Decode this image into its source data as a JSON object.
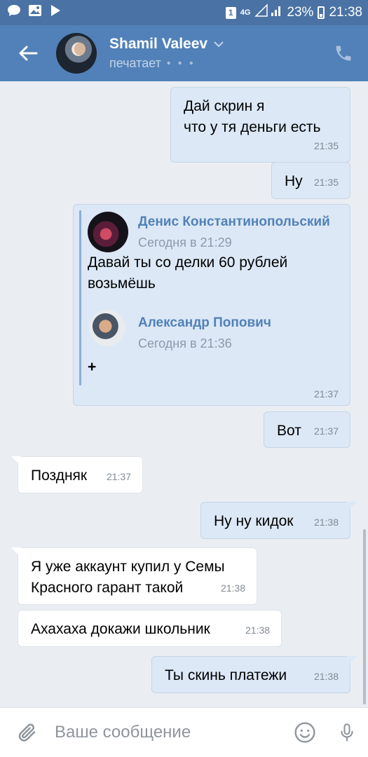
{
  "status_bar": {
    "network": "4G",
    "battery": "23%",
    "time": "21:38"
  },
  "header": {
    "name": "Shamil Valeev",
    "status": "печатает",
    "typing_dots": "• • •"
  },
  "messages": [
    {
      "dir": "out",
      "text": "Дай скрин я\n  что у тя деньги есть",
      "time": "21:35"
    },
    {
      "dir": "out",
      "text": "Ну",
      "time": "21:35"
    },
    {
      "dir": "out",
      "time": "21:37"
    },
    {
      "dir": "out",
      "text": "Вот",
      "time": "21:37"
    },
    {
      "dir": "in",
      "text": "Поздняк",
      "time": "21:37"
    },
    {
      "dir": "out",
      "text": "Ну ну кидок",
      "time": "21:38"
    },
    {
      "dir": "in",
      "text": "Я уже аккаунт купил у Семы\nКрасного гарант такой",
      "time": "21:38"
    },
    {
      "dir": "in",
      "text": "Ахахаха докажи школьник",
      "time": "21:38"
    },
    {
      "dir": "out",
      "text": "Ты скинь платежи",
      "time": "21:38"
    }
  ],
  "forwarded": {
    "author": "Денис Константинопольский",
    "date": "Сегодня в 21:29",
    "text": "Давай ты со делки 60 рублей возьмёшь",
    "nested_author": "Александр Попович",
    "nested_date": "Сегодня в 21:36",
    "nested_text": "+"
  },
  "composer": {
    "placeholder": "Ваше сообщение"
  },
  "colors": {
    "header": "#5181b8",
    "status_bar": "#4a72a4",
    "outgoing_bubble": "#dce8f6",
    "incoming_bubble": "#ffffff",
    "background": "#eaeef3"
  },
  "icons": [
    "chat-icon",
    "gallery-icon",
    "play-store-icon",
    "sim-icon",
    "signal-icon",
    "battery-icon",
    "back-arrow-icon",
    "chevron-down-icon",
    "phone-icon",
    "attach-icon",
    "emoji-icon",
    "mic-icon"
  ]
}
